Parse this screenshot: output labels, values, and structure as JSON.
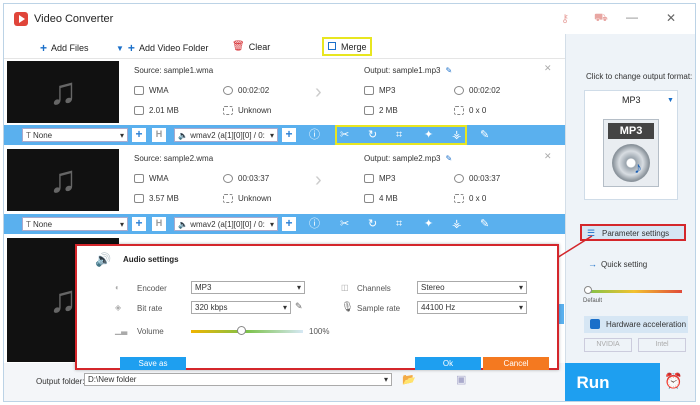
{
  "window": {
    "title": "Video Converter"
  },
  "toolbar": {
    "add_files": "Add Files",
    "add_video_folder": "Add Video Folder",
    "clear": "Clear",
    "merge": "Merge"
  },
  "files": [
    {
      "source": "Source: sample1.wma",
      "src_format": "WMA",
      "src_duration": "00:02:02",
      "src_size": "2.01 MB",
      "src_resolution": "Unknown",
      "output": "Output: sample1.mp3",
      "out_format": "MP3",
      "out_duration": "00:02:02",
      "out_size": "2 MB",
      "out_resolution": "0 x 0",
      "subtitle": "None",
      "audio_track": "wmav2 (a[1][0][0] / 0:"
    },
    {
      "source": "Source: sample2.wma",
      "src_format": "WMA",
      "src_duration": "00:03:37",
      "src_size": "3.57 MB",
      "src_resolution": "Unknown",
      "output": "Output: sample2.mp3",
      "out_format": "MP3",
      "out_duration": "00:03:37",
      "out_size": "4 MB",
      "out_resolution": "0 x 0",
      "subtitle": "None",
      "audio_track": "wmav2 (a[1][0][0] / 0:"
    }
  ],
  "right_panel": {
    "hint": "Click to change output format:",
    "format": "MP3",
    "format_badge": "MP3",
    "parameter_settings": "Parameter settings",
    "quick_setting": "Quick setting",
    "default_label": "Default",
    "hardware_acceleration": "Hardware acceleration",
    "nvidia": "NVIDIA",
    "intel": "Intel",
    "run": "Run"
  },
  "audio_settings": {
    "title": "Audio settings",
    "encoder_label": "Encoder",
    "encoder": "MP3",
    "bitrate_label": "Bit rate",
    "bitrate": "320 kbps",
    "volume_label": "Volume",
    "volume": "100%",
    "volume_level": 0.45,
    "channels_label": "Channels",
    "channels": "Stereo",
    "sample_rate_label": "Sample rate",
    "sample_rate": "44100 Hz",
    "save_as": "Save as",
    "ok": "Ok",
    "cancel": "Cancel"
  },
  "bottom": {
    "output_folder_label": "Output folder:",
    "output_folder": "D:\\New folder"
  },
  "colors": {
    "accent": "#1e9ff0",
    "highlight": "#e8e620",
    "alert": "#d4262b",
    "cancel": "#f47920",
    "bar": "#5ab0ee"
  }
}
